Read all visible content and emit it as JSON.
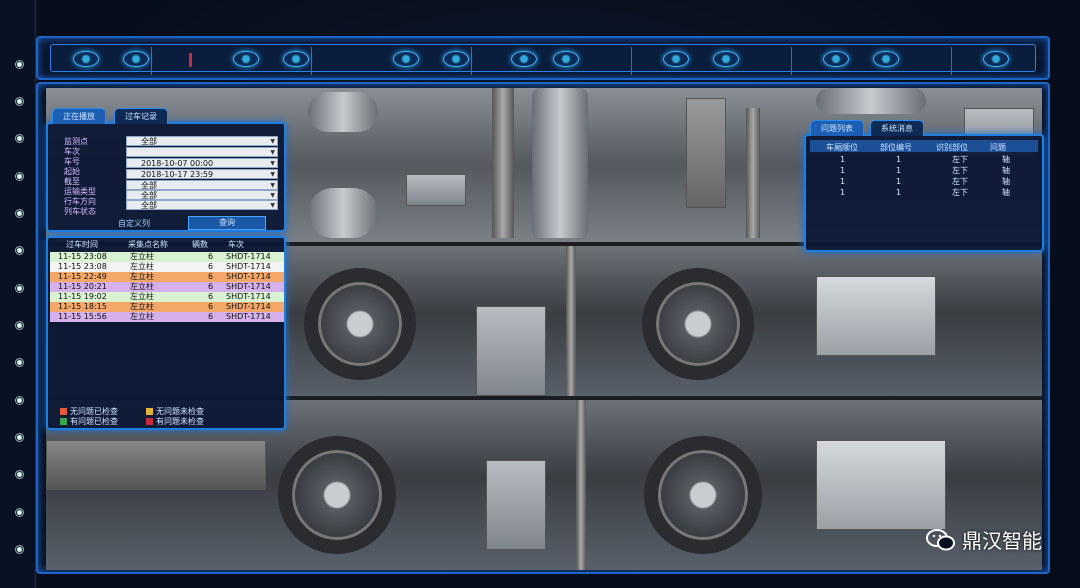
{
  "left_panel": {
    "tabs": [
      "正在播放",
      "过车记录"
    ],
    "filters": [
      {
        "label": "监测点",
        "value": "全部"
      },
      {
        "label": "车次",
        "value": ""
      },
      {
        "label": "车号",
        "value": "2018-10-07  00:00"
      },
      {
        "label": "起始",
        "value": "2018-10-17  23:59"
      },
      {
        "label": "截至",
        "value": "全部"
      },
      {
        "label": "运输类型",
        "value": "全部"
      },
      {
        "label": "行车方向",
        "value": "全部"
      },
      {
        "label": "列车状态",
        "value": ""
      }
    ],
    "custom_columns_label": "自定义列",
    "query_button": "查询",
    "table_headers": [
      "过车时间",
      "采集点名称",
      "辆数",
      "车次"
    ],
    "rows": [
      {
        "time": "11-15  23:08",
        "site": "左立柱",
        "count": "6",
        "train": "SHDT-1714",
        "color": "#d8f2d2"
      },
      {
        "time": "11-15  23:08",
        "site": "左立柱",
        "count": "6",
        "train": "SHDT-1714",
        "color": "#f3f3f3"
      },
      {
        "time": "11-15  22:49",
        "site": "左立柱",
        "count": "6",
        "train": "SHDT-1714",
        "color": "#f3a86a"
      },
      {
        "time": "11-15  20:21",
        "site": "左立柱",
        "count": "6",
        "train": "SHDT-1714",
        "color": "#d5b0ea"
      },
      {
        "time": "11-15  19:02",
        "site": "左立柱",
        "count": "6",
        "train": "SHDT-1714",
        "color": "#d8f2d2"
      },
      {
        "time": "11-15  18:15",
        "site": "左立柱",
        "count": "6",
        "train": "SHDT-1714",
        "color": "#f3a86a"
      },
      {
        "time": "11-15  15:56",
        "site": "左立柱",
        "count": "6",
        "train": "SHDT-1714",
        "color": "#d5b0ea"
      }
    ],
    "legend": [
      {
        "label": "无问题已检查",
        "color": "#e8583a"
      },
      {
        "label": "无问题未检查",
        "color": "#e6b43a"
      },
      {
        "label": "有问题已检查",
        "color": "#3aa84a"
      },
      {
        "label": "有问题未检查",
        "color": "#c8283a"
      }
    ]
  },
  "right_panel": {
    "tabs": [
      "问题列表",
      "系统消息"
    ],
    "headers": [
      "车厢顺位",
      "部位编号",
      "识别部位",
      "问题"
    ],
    "rows": [
      [
        "1",
        "1",
        "左下",
        "轴"
      ],
      [
        "1",
        "1",
        "左下",
        "轴"
      ],
      [
        "1",
        "1",
        "左下",
        "轴"
      ],
      [
        "1",
        "1",
        "左下",
        "轴"
      ]
    ]
  },
  "watermark": "鼎汉智能",
  "colors": {
    "accent": "#1f7fe0",
    "frame": "#1f64c8",
    "background": "#07101f"
  }
}
